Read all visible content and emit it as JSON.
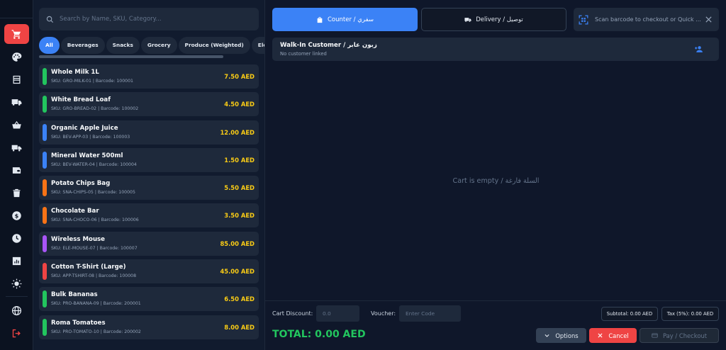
{
  "sidebar": {
    "items": [
      {
        "icon": "cart-icon",
        "active": true
      },
      {
        "icon": "palette-icon"
      },
      {
        "icon": "inventory-icon"
      },
      {
        "icon": "truck-icon"
      },
      {
        "icon": "basket-icon"
      },
      {
        "icon": "delivery-truck-icon"
      },
      {
        "icon": "wallet-icon"
      },
      {
        "icon": "trash-icon"
      },
      {
        "icon": "dollar-icon"
      },
      {
        "icon": "clock-icon"
      },
      {
        "icon": "report-icon"
      },
      {
        "icon": "sun-icon"
      }
    ],
    "bottom": [
      {
        "icon": "globe-icon"
      },
      {
        "icon": "logout-icon"
      }
    ]
  },
  "search": {
    "placeholder": "Search by Name, SKU, Category..."
  },
  "categories": [
    "All",
    "Beverages",
    "Snacks",
    "Grocery",
    "Produce (Weighted)",
    "Electronics"
  ],
  "products": [
    {
      "name": "Whole Milk 1L",
      "meta": "SKU: GRO-MILK-01 | Barcode: 100001",
      "price": "7.50 AED",
      "color": "#22c55e"
    },
    {
      "name": "White Bread Loaf",
      "meta": "SKU: GRO-BREAD-02 | Barcode: 100002",
      "price": "4.50 AED",
      "color": "#22c55e"
    },
    {
      "name": "Organic Apple Juice",
      "meta": "SKU: BEV-APP-03 | Barcode: 100003",
      "price": "12.00 AED",
      "color": "#3b82f6"
    },
    {
      "name": "Mineral Water 500ml",
      "meta": "SKU: BEV-WATER-04 | Barcode: 100004",
      "price": "1.50 AED",
      "color": "#3b82f6"
    },
    {
      "name": "Potato Chips Bag",
      "meta": "SKU: SNA-CHIPS-05 | Barcode: 100005",
      "price": "5.50 AED",
      "color": "#f97316"
    },
    {
      "name": "Chocolate Bar",
      "meta": "SKU: SNA-CHOCO-06 | Barcode: 100006",
      "price": "3.50 AED",
      "color": "#f97316"
    },
    {
      "name": "Wireless Mouse",
      "meta": "SKU: ELE-MOUSE-07 | Barcode: 100007",
      "price": "85.00 AED",
      "color": "#a855f7"
    },
    {
      "name": "Cotton T-Shirt (Large)",
      "meta": "SKU: APP-TSHIRT-08 | Barcode: 100008",
      "price": "45.00 AED",
      "color": "#ef4444"
    },
    {
      "name": "Bulk Bananas",
      "meta": "SKU: PRO-BANANA-09 | Barcode: 200001",
      "price": "6.50 AED",
      "color": "#22c55e"
    },
    {
      "name": "Roma Tomatoes",
      "meta": "SKU: PRO-TOMATO-10 | Barcode: 200002",
      "price": "8.00 AED",
      "color": "#22c55e"
    }
  ],
  "order_tabs": {
    "counter": "Counter / سفري",
    "delivery": "Delivery / توصيل"
  },
  "scan": {
    "placeholder": "Scan barcode to checkout or Quick ..."
  },
  "customer": {
    "name": "Walk-In Customer / زبون عابر",
    "status": "No customer linked"
  },
  "cart": {
    "empty_text": "Cart is empty / السلة فارغة"
  },
  "footer": {
    "discount_label": "Cart Discount:",
    "discount_placeholder": "0.0",
    "voucher_label": "Voucher:",
    "voucher_placeholder": "Enter Code",
    "subtotal": "Subtotal: 0.00 AED",
    "tax": "Tax (5%): 0.00 AED",
    "total": "TOTAL: 0.00 AED",
    "options_label": "Options",
    "cancel_label": "Cancel",
    "pay_label": "Pay / Checkout"
  },
  "colors": {
    "accent": "#3b82f6",
    "danger": "#ef4444",
    "total": "#22c55e",
    "price": "#facc15"
  }
}
